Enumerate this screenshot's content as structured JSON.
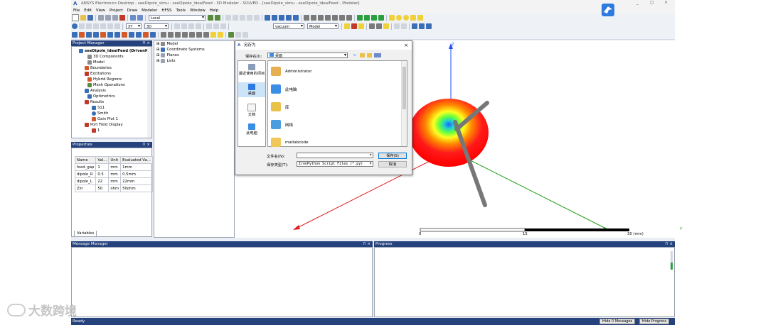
{
  "window": {
    "title": "ANSYS Electronics Desktop - seeDipole_simu - seeDipole_idealFeed - 3D Modeler - SOLVED - [seeDipole_simu - seeDipole_idealFeed - Modeler]",
    "controls": [
      "_",
      "□",
      "×"
    ]
  },
  "menu": [
    "File",
    "Edit",
    "View",
    "Project",
    "Draw",
    "Modeler",
    "HFSS",
    "Tools",
    "Window",
    "Help"
  ],
  "toolbar": {
    "cs_combo": "Local",
    "plane_combo": "XY",
    "dim_combo": "3D",
    "material_combo": "vacuum",
    "model_combo": "Model"
  },
  "project_manager": {
    "title": "Project Manager",
    "items": [
      {
        "label": "seeDipole_idealFeed (DrivenMo",
        "depth": 0,
        "bold": true
      },
      {
        "label": "3D Components",
        "depth": 2
      },
      {
        "label": "Model",
        "depth": 2
      },
      {
        "label": "Boundaries",
        "depth": 1
      },
      {
        "label": "Excitations",
        "depth": 1
      },
      {
        "label": "Hybrid Regions",
        "depth": 2
      },
      {
        "label": "Mesh Operations",
        "depth": 2
      },
      {
        "label": "Analysis",
        "depth": 1
      },
      {
        "label": "Optimetrics",
        "depth": 2
      },
      {
        "label": "Results",
        "depth": 1
      },
      {
        "label": "S11",
        "depth": 2
      },
      {
        "label": "Smith",
        "depth": 2
      },
      {
        "label": "Gain Plot 1",
        "depth": 2
      },
      {
        "label": "Port Field Display",
        "depth": 1
      },
      {
        "label": "1",
        "depth": 2
      }
    ]
  },
  "properties": {
    "title": "Properties",
    "headers": [
      "Name",
      "Val...",
      "Unit",
      "Evaluated Va..."
    ],
    "rows": [
      [
        "feed_gap",
        "1",
        "mm",
        "1mm"
      ],
      [
        "dipole_R",
        "0.5",
        "mm",
        "0.5mm"
      ],
      [
        "dipole_L",
        "22",
        "mm",
        "22mm"
      ],
      [
        "Zin",
        "50",
        "ohm",
        "50ohm"
      ]
    ],
    "tab": "Variables"
  },
  "model_tree": [
    "Model",
    "Coordinate Systems",
    "Planes",
    "Lists"
  ],
  "save_dialog": {
    "title": "另存为",
    "save_in_label": "保存在(I):",
    "save_in_value": "桌面",
    "places": [
      "最近使用的项目",
      "桌面",
      "文档",
      "此电脑"
    ],
    "files": [
      "Administrator",
      "此电脑",
      "库",
      "网络",
      "matlabcode"
    ],
    "filename_label": "文件名(N):",
    "filename_value": "",
    "filetype_label": "保存类型(T):",
    "filetype_value": "IronPython Script Files (*.py)",
    "save_button": "保存(S)",
    "cancel_button": "取消"
  },
  "viewport": {
    "axis_z": "Z",
    "axis_y": "Y",
    "scale_labels": [
      "0",
      "15",
      "30 (mm)"
    ]
  },
  "message_manager": {
    "title": "Message Manager"
  },
  "progress": {
    "title": "Progress"
  },
  "status": {
    "text": "Ready",
    "hide_messages": "Hide 0 Messages",
    "hide_progress": "Hide Progress"
  },
  "watermark": "大数跨境",
  "colors": {
    "pane_header": "#25427d",
    "status_bar": "#25427d",
    "accent": "#0078d7"
  }
}
